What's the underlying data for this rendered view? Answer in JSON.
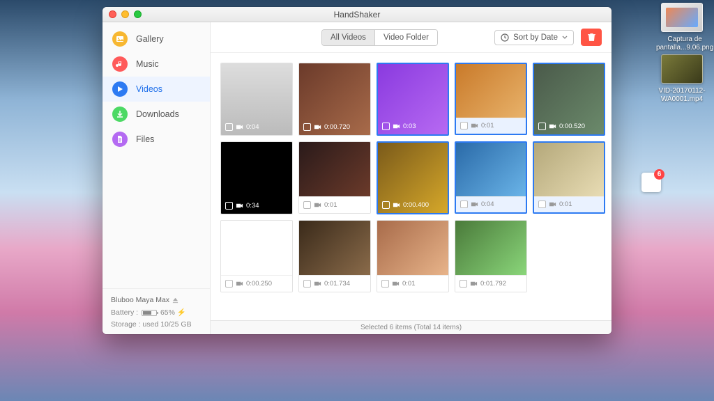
{
  "app_title": "HandShaker",
  "sidebar": {
    "items": [
      {
        "label": "Gallery",
        "icon": "image",
        "color": "#f7b731"
      },
      {
        "label": "Music",
        "icon": "note",
        "color": "#ff5a5a"
      },
      {
        "label": "Videos",
        "icon": "play",
        "color": "#2d7af2"
      },
      {
        "label": "Downloads",
        "icon": "download",
        "color": "#4cd964"
      },
      {
        "label": "Files",
        "icon": "file",
        "color": "#b46af2"
      }
    ],
    "active_index": 2
  },
  "device": {
    "name": "Bluboo Maya Max",
    "battery_label": "Battery :",
    "battery_pct": "65%",
    "storage_label": "Storage : used 10/25 GB"
  },
  "tabs": {
    "options": [
      "All Videos",
      "Video Folder"
    ],
    "active_index": 0
  },
  "sort_label": "Sort by Date",
  "grid": [
    {
      "dur": "0:04",
      "sel": false,
      "dark": true,
      "bg": "linear-gradient(#ddd,#bbb)"
    },
    {
      "dur": "0:00.720",
      "sel": false,
      "dark": true,
      "bg": "linear-gradient(135deg,#6b3a2a,#a86b4a)"
    },
    {
      "dur": "0:03",
      "sel": true,
      "dark": true,
      "bg": "linear-gradient(135deg,#8a3adf,#b76af2)"
    },
    {
      "dur": "0:01",
      "sel": true,
      "dark": false,
      "bg": "linear-gradient(135deg,#c97a2a,#e8b26a)"
    },
    {
      "dur": "0:00.520",
      "sel": true,
      "dark": true,
      "bg": "linear-gradient(135deg,#4a5a4a,#6b8a6b)"
    },
    {
      "dur": "0:34",
      "sel": false,
      "dark": true,
      "bg": "#000"
    },
    {
      "dur": "0:01",
      "sel": false,
      "dark": false,
      "bg": "linear-gradient(135deg,#2a1a1a,#6b3a2a)"
    },
    {
      "dur": "0:00.400",
      "sel": true,
      "dark": true,
      "bg": "linear-gradient(135deg,#7a5a1a,#d6a82a)"
    },
    {
      "dur": "0:04",
      "sel": true,
      "dark": false,
      "bg": "linear-gradient(135deg,#2a6aa8,#6ab4e8)"
    },
    {
      "dur": "0:01",
      "sel": true,
      "dark": false,
      "bg": "linear-gradient(135deg,#b4a87a,#e8dcb4)"
    },
    {
      "dur": "0:00.250",
      "sel": false,
      "dark": false,
      "bg": "#fff"
    },
    {
      "dur": "0:01.734",
      "sel": false,
      "dark": false,
      "bg": "linear-gradient(135deg,#3a2a1a,#8a6b4a)"
    },
    {
      "dur": "0:01",
      "sel": false,
      "dark": false,
      "bg": "linear-gradient(135deg,#a86b4a,#e8b48a)"
    },
    {
      "dur": "0:01.792",
      "sel": false,
      "dark": false,
      "bg": "linear-gradient(135deg,#4a7a3a,#8ad67a)"
    }
  ],
  "statusbar": "Selected 6 items (Total 14 items)",
  "desktop": {
    "icon1_label": "Captura de pantalla...9.06.png",
    "icon2_label": "VID-20170112-WA0001.mp4",
    "badge_count": "6"
  }
}
